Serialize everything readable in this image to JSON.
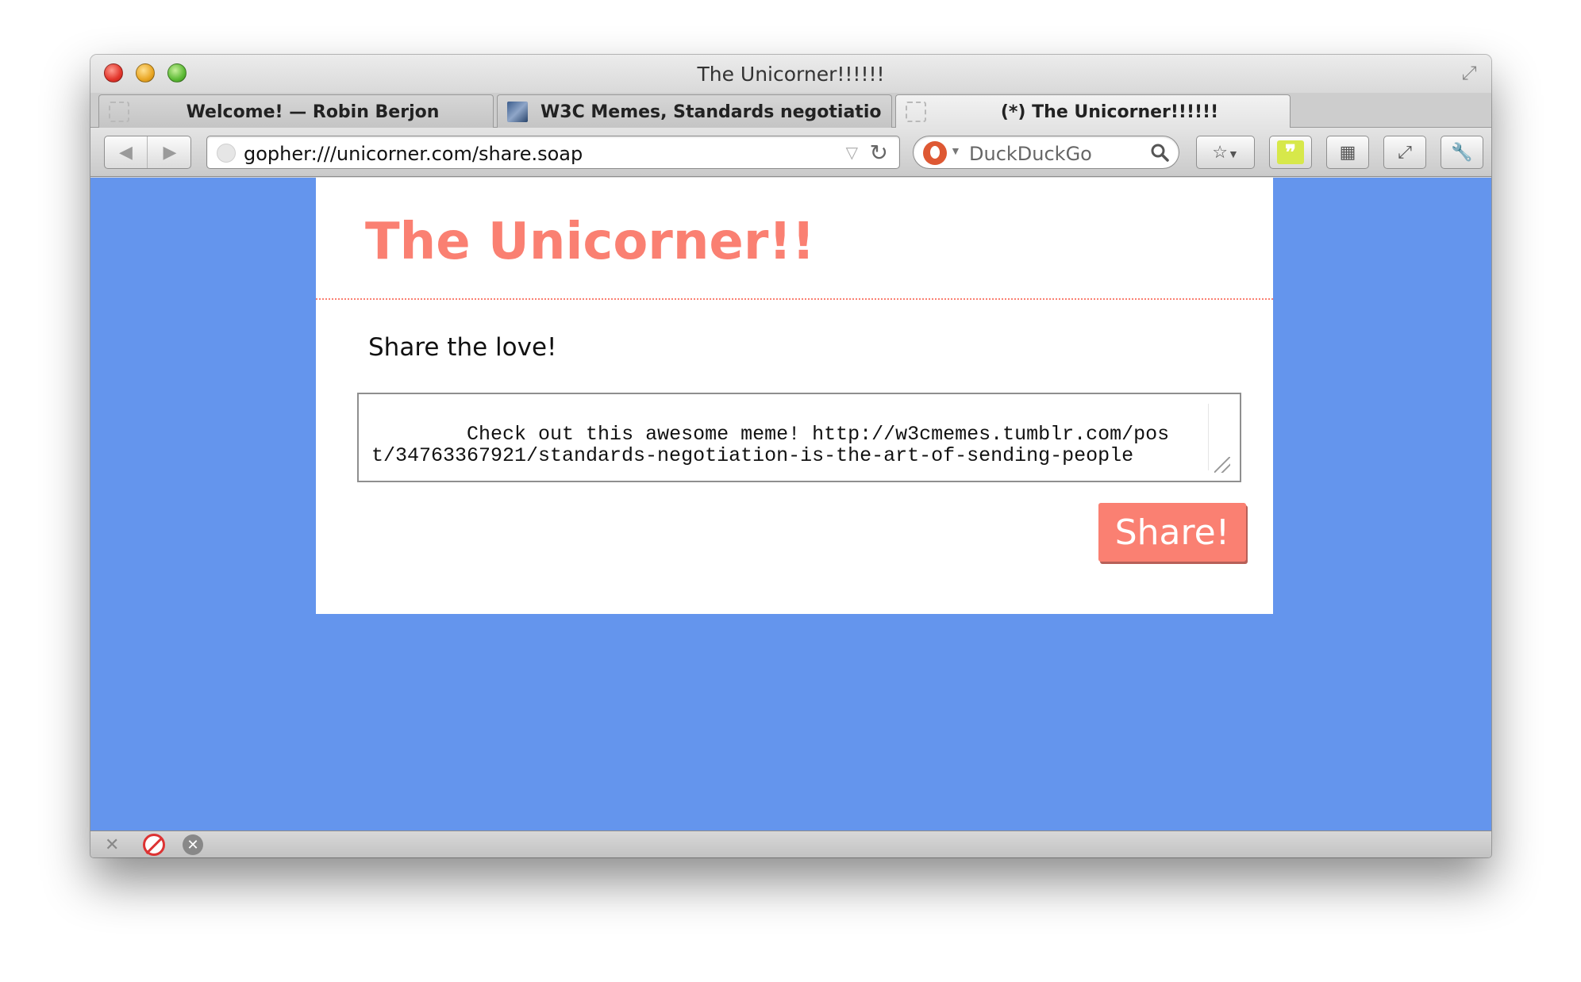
{
  "window": {
    "title": "The Unicorner!!!!!!"
  },
  "tabs": [
    {
      "label": "Welcome! — Robin Berjon",
      "active": false,
      "icon": "blank-page-icon"
    },
    {
      "label": "W3C Memes, Standards negotiatio...",
      "active": false,
      "icon": "tumblr-thumb-icon"
    },
    {
      "label": "(*) The Unicorner!!!!!!",
      "active": true,
      "icon": "blank-page-icon"
    }
  ],
  "toolbar": {
    "url": "gopher:///unicorner.com/share.soap",
    "search_engine": "DuckDuckGo",
    "search_placeholder": "DuckDuckGo"
  },
  "page": {
    "title": "The Unicorner!!",
    "share_heading": "Share the love!",
    "share_text": "Check out this awesome meme! http://w3cmemes.tumblr.com/post/34763367921/standards-negotiation-is-the-art-of-sending-people",
    "share_button": "Share!"
  },
  "colors": {
    "page_background": "#6495ed",
    "accent": "#fa8072"
  }
}
